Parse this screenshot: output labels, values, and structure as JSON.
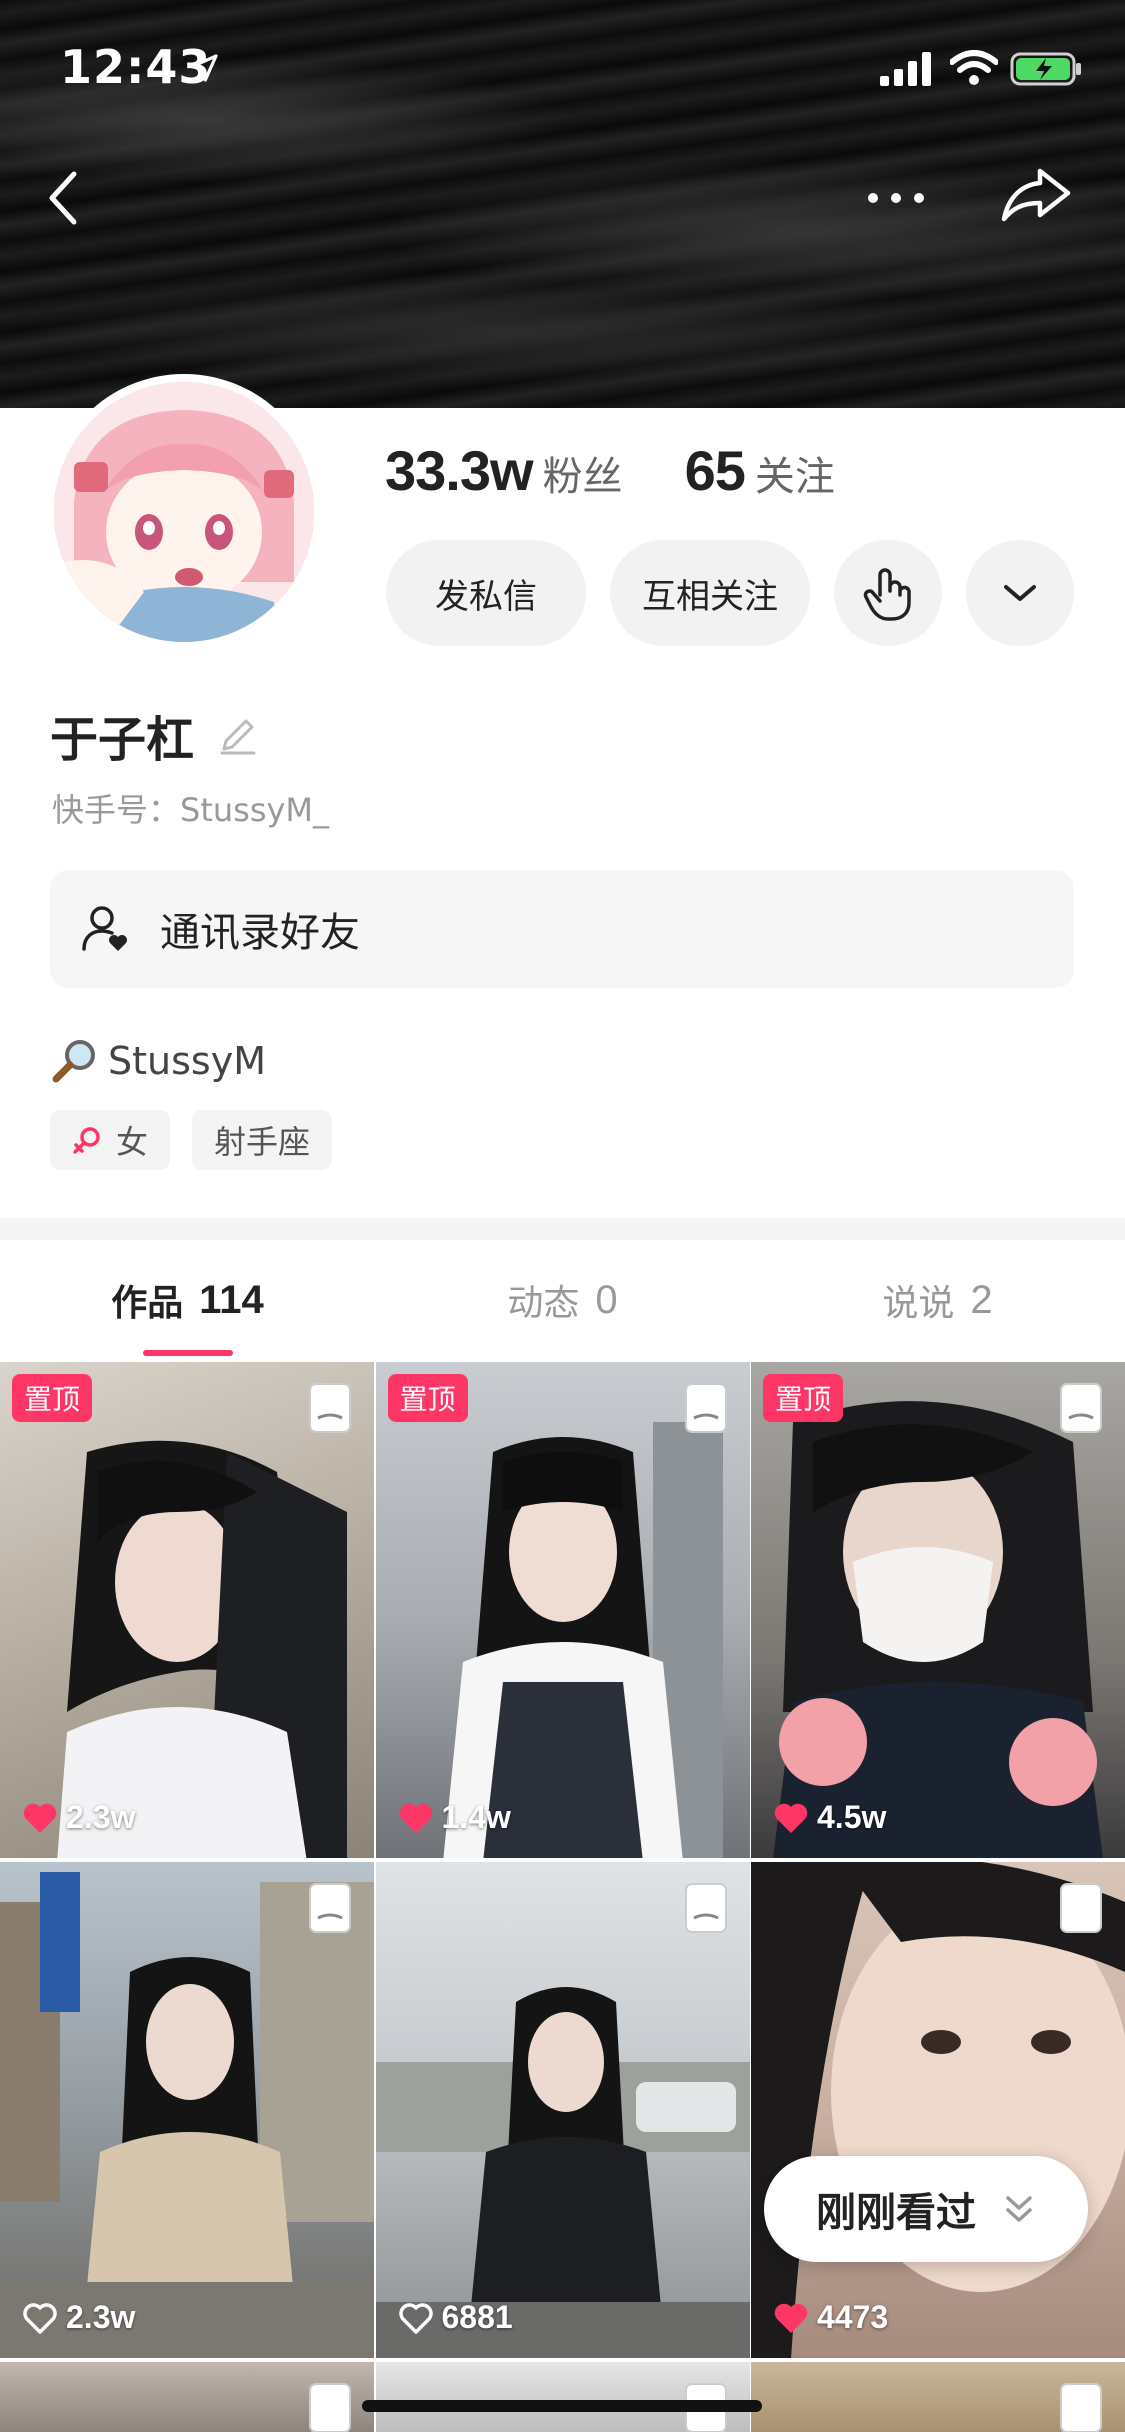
{
  "status_bar": {
    "time": "12:43"
  },
  "profile": {
    "followers_count": "33.3w",
    "followers_label": "粉丝",
    "following_count": "65",
    "following_label": "关注",
    "message_label": "发私信",
    "mutual_label": "互相关注",
    "name": "于子杠",
    "kuaishou_id": "快手号：StussyM_",
    "contacts_label": "通讯录好友",
    "bio": "StussyM",
    "tags": [
      "女",
      "射手座"
    ]
  },
  "tabs": [
    {
      "label": "作品",
      "count": "114"
    },
    {
      "label": "动态",
      "count": "0"
    },
    {
      "label": "说说",
      "count": "2"
    }
  ],
  "posts": [
    {
      "pinned": true,
      "pin_label": "置顶",
      "likes": "2.3w",
      "liked": true
    },
    {
      "pinned": true,
      "pin_label": "置顶",
      "likes": "1.4w",
      "liked": true
    },
    {
      "pinned": true,
      "pin_label": "置顶",
      "likes": "4.5w",
      "liked": true
    },
    {
      "pinned": false,
      "likes": "2.3w",
      "liked": false
    },
    {
      "pinned": false,
      "likes": "6881",
      "liked": false
    },
    {
      "pinned": false,
      "likes": "4473",
      "liked": true
    }
  ],
  "recently_viewed_label": "刚刚看过",
  "colors": {
    "accent": "#fe3666"
  }
}
